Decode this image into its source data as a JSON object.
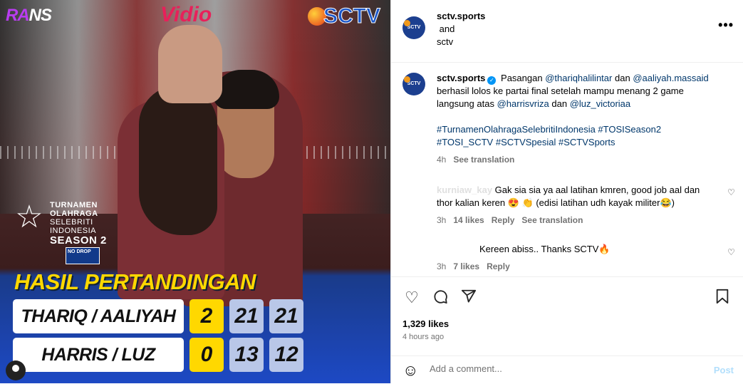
{
  "media": {
    "logos": {
      "rans_a": "RA",
      "rans_b": "NS",
      "vidio": "Vidio",
      "sctv": "SCTV"
    },
    "tosi": {
      "line1": "TURNAMEN",
      "line2": "OLAHRAGA",
      "line3": "SELEBRITI",
      "line4": "INDONESIA",
      "line5": "SEASON 2",
      "badge": "NO DROP"
    },
    "headline": "HASIL PERTANDINGAN",
    "rows": [
      {
        "name": "THARIQ / AALIYAH",
        "sets": "2",
        "game1": "21",
        "game2": "21"
      },
      {
        "name": "HARRIS / LUZ",
        "sets": "0",
        "game1": "13",
        "game2": "12"
      }
    ]
  },
  "header": {
    "account1": "sctv.sports",
    "and": "and",
    "account2": "sctv",
    "avatar_text": "SCTV SPORTS"
  },
  "caption": {
    "user": "sctv.sports",
    "text1": "Pasangan",
    "mention1": "@thariqhalilintar",
    "text2": "dan",
    "mention2": "@aaliyah.massaid",
    "text3": "berhasil lolos ke partai final setelah mampu menang 2 game langsung atas",
    "mention3": "@harrisvriza",
    "text4": "dan",
    "mention4": "@luz_victoriaa",
    "tags1": "#TurnamenOlahragaSelebritiIndonesia #TOSISeason2",
    "tags2": "#TOSI_SCTV #SCTVSpesial #SCTVSports",
    "time": "4h",
    "see_translation": "See translation"
  },
  "comments": [
    {
      "user": "kurniaw_kay",
      "text": "Gak sia sia ya aal latihan kmren, good job aal dan thor kalian keren 😍 👏 (edisi latihan udh kayak militer😂)",
      "time": "3h",
      "likes": "14 likes",
      "reply": "Reply",
      "see_translation": "See translation"
    },
    {
      "user": "",
      "text": "Kereen abiss.. Thanks SCTV🔥",
      "time": "3h",
      "likes": "7 likes",
      "reply": "Reply"
    }
  ],
  "actions": {
    "likes": "1,329 likes",
    "time": "4 hours ago",
    "comment_placeholder": "Add a comment...",
    "post": "Post"
  }
}
